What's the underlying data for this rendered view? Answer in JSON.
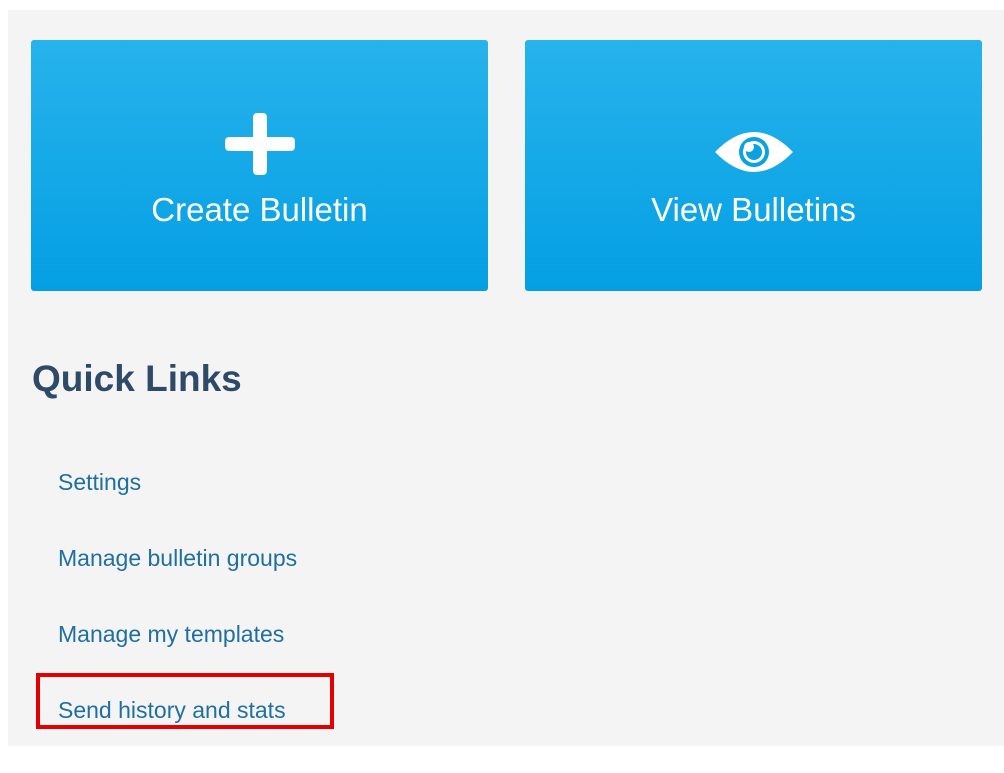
{
  "tiles": {
    "create": {
      "label": "Create Bulletin",
      "icon": "plus-icon"
    },
    "view": {
      "label": "View Bulletins",
      "icon": "eye-icon"
    }
  },
  "quick_links": {
    "heading": "Quick Links",
    "items": [
      {
        "label": "Settings"
      },
      {
        "label": "Manage bulletin groups"
      },
      {
        "label": "Manage my templates"
      },
      {
        "label": "Send history and stats",
        "highlighted": true
      }
    ]
  },
  "colors": {
    "tile_blue": "#0ca4e6",
    "heading": "#2e4a66",
    "link": "#1f6f9f",
    "highlight": "#e30000",
    "background": "#f4f4f4"
  }
}
